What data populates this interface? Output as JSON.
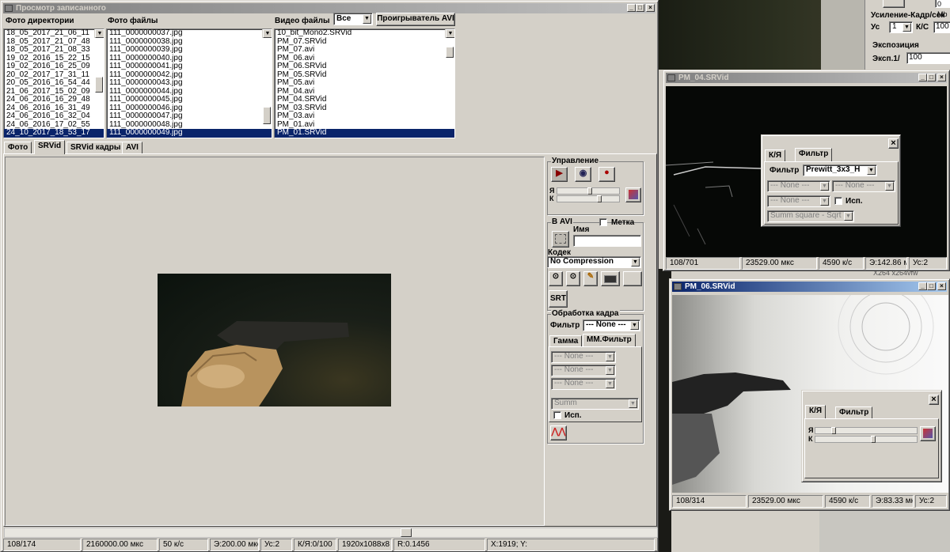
{
  "main_window": {
    "title": "Просмотр записанного",
    "dir_header": "Фото директории",
    "photo_header": "Фото файлы",
    "video_header": "Видео файлы",
    "video_filter": "Все",
    "avi_player_button": "Проигрыватель AVI",
    "dirs": [
      "18_05_2017_21_06_11",
      "18_05_2017_21_07_48",
      "18_05_2017_21_08_33",
      "19_02_2016_15_22_15",
      "19_02_2016_16_25_09",
      "20_02_2017_17_31_11",
      "20_05_2016_16_54_44",
      "21_06_2017_15_02_09",
      "24_06_2016_16_29_48",
      "24_06_2016_16_31_49",
      "24_06_2016_16_32_04",
      "24_06_2016_17_02_55",
      "24_10_2017_18_53_17"
    ],
    "photos": [
      "111_0000000037.jpg",
      "111_0000000038.jpg",
      "111_0000000039.jpg",
      "111_0000000040.jpg",
      "111_0000000041.jpg",
      "111_0000000042.jpg",
      "111_0000000043.jpg",
      "111_0000000044.jpg",
      "111_0000000045.jpg",
      "111_0000000046.jpg",
      "111_0000000047.jpg",
      "111_0000000048.jpg",
      "111_0000000049.jpg"
    ],
    "videos": [
      "10_bit_Mono2.SRVid",
      "PM_07.SRVid",
      "PM_07.avi",
      "PM_06.avi",
      "PM_06.SRVid",
      "PM_05.SRVid",
      "PM_05.avi",
      "PM_04.avi",
      "PM_04.SRVid",
      "PM_03.SRVid",
      "PM_03.avi",
      "PM_01.avi",
      "PM_01.SRVid"
    ],
    "tabs": [
      "Фото",
      "SRVid",
      "SRVid кадры",
      "AVI"
    ],
    "control": {
      "title": "Управление",
      "ya": "Я",
      "k": "К"
    },
    "avi": {
      "title": "В AVI",
      "name_label": "Имя",
      "mark_label": "Метка",
      "codec_label": "Кодек",
      "codec": "No Compression",
      "srt": "SRT"
    },
    "processing": {
      "title": "Обработка кадра",
      "filter_label": "Фильтр",
      "filter_value": "--- None ---",
      "tab_gamma": "Гамма",
      "tab_mm": "ММ.Фильтр",
      "none1": "--- None ---",
      "none2": "--- None ---",
      "none3": "--- None ---",
      "summ": "Summ",
      "use_label": "Исп."
    },
    "status": [
      "108/174",
      "2160000.00 мкс",
      "50 к/с",
      "Э:200.00 мкс",
      "Ус:2",
      "К/Я:0/100",
      "1920x1088x8",
      "R:0.1456",
      "X:1919; Y:"
    ]
  },
  "right_panel": {
    "gain_label": "Усиление-Кадр/сек",
    "us_label": "Ус",
    "us_value": "1",
    "ks_label": "К/С",
    "ks_value": "100",
    "exposure_label": "Экспозиция",
    "exp_label": "Эксп.1/",
    "exp_value": "100",
    "bg_text": "X264 x264vfw"
  },
  "win_pm04": {
    "title": "PM_04.SRVid",
    "filter_dialog": {
      "tab_ky": "К/Я",
      "tab_filter": "Фильтр",
      "filter_label": "Фильтр",
      "filter_value": "Prewitt_3x3_H",
      "none_a": "--- None ---",
      "none_b": "--- None ---",
      "none_c": "--- None ---",
      "use_label": "Исп.",
      "summ": "Summ square - Sqrt"
    },
    "status": [
      "108/701",
      "23529.00 мкс",
      "4590 к/с",
      "Э:142.86 мкс",
      "Ус:2"
    ]
  },
  "win_pm06": {
    "title": "PM_06.SRVid",
    "dialog": {
      "tab_ky": "К/Я",
      "tab_filter": "Фильтр",
      "ya": "Я",
      "k": "К"
    },
    "status": [
      "108/314",
      "23529.00 мкс",
      "4590 к/с",
      "Э:83.33 мкс",
      "Ус:2"
    ]
  }
}
